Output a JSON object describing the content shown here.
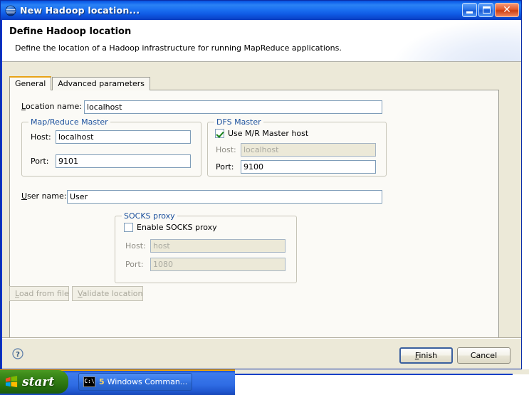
{
  "window": {
    "title": "New Hadoop location...",
    "icon": "hadoop-globe-icon",
    "minimize_label": "Minimize",
    "maximize_label": "Maximize",
    "close_label": "Close"
  },
  "banner": {
    "title": "Define Hadoop location",
    "description": "Define the location of a Hadoop infrastructure for running MapReduce applications."
  },
  "tabs": [
    {
      "label": "General",
      "active": true
    },
    {
      "label": "Advanced parameters",
      "active": false
    }
  ],
  "form": {
    "location_name": {
      "label": "Location name:",
      "accel": "L",
      "value": "localhost",
      "placeholder": ""
    },
    "mapreduce_master": {
      "legend": "Map/Reduce Master",
      "host": {
        "label": "Host:",
        "value": "localhost",
        "enabled": true
      },
      "port": {
        "label": "Port:",
        "value": "9101",
        "enabled": true
      }
    },
    "dfs_master": {
      "legend": "DFS Master",
      "use_mr_master_host": {
        "label": "Use M/R Master host",
        "checked": true
      },
      "host": {
        "label": "Host:",
        "value": "localhost",
        "enabled": false
      },
      "port": {
        "label": "Port:",
        "value": "9100",
        "enabled": true
      }
    },
    "user_name": {
      "label": "User name:",
      "accel": "U",
      "value": "User"
    },
    "socks_proxy": {
      "legend": "SOCKS proxy",
      "enable": {
        "label": "Enable SOCKS proxy",
        "checked": false
      },
      "host": {
        "label": "Host:",
        "value": "host",
        "enabled": false
      },
      "port": {
        "label": "Port:",
        "value": "1080",
        "enabled": false
      }
    }
  },
  "actions": {
    "load_from_file": {
      "label": "Load from file",
      "enabled": false
    },
    "validate_location": {
      "label": "Validate location",
      "enabled": false
    }
  },
  "footer": {
    "help_label": "?",
    "finish": "Finish",
    "cancel": "Cancel"
  },
  "taskbar": {
    "start_label": "start",
    "task": {
      "icon": "command-prompt-icon",
      "icon_text": "C:\\",
      "count": "5",
      "label": "Windows Comman..."
    }
  },
  "colors": {
    "titlebar_blue": "#1a6ff0",
    "tab_accent": "#e8a317",
    "group_legend": "#1a4f9c",
    "dialog_bg": "#ece9d8",
    "field_border": "#7f9db9",
    "check_green": "#148014",
    "taskbar_blue": "#2f6ce4",
    "start_green": "#2f7a12"
  }
}
